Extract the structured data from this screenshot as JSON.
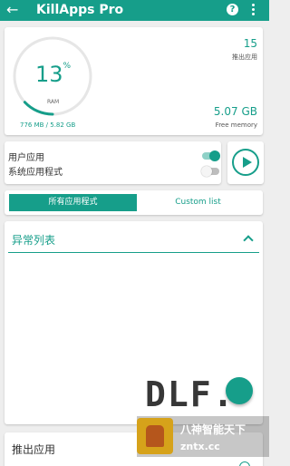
{
  "appbar": {
    "title": "KillApps Pro",
    "back_icon": "←",
    "help_icon": "?"
  },
  "ram": {
    "percent": "13",
    "percent_sign": "%",
    "label": "RAM",
    "usage": "776 MB / 5.82 GB",
    "used_fraction": 0.13,
    "process_count": "15",
    "process_label": "推出应用",
    "free_value": "5.07 GB",
    "free_label": "Free memory"
  },
  "filters": {
    "user_apps": {
      "label": "用户应用",
      "on": true
    },
    "system_apps": {
      "label": "系统应用程式",
      "on": false
    }
  },
  "tabs": {
    "all": "所有应用程式",
    "custom": "Custom list"
  },
  "anomaly": {
    "title": "异常列表"
  },
  "exit": {
    "title": "推出应用"
  },
  "watermark": {
    "mark": "DLF.",
    "line1": "八神智能天下",
    "line2": "zntx.cc"
  },
  "colors": {
    "accent": "#169e8a",
    "background": "#eeeeee"
  }
}
